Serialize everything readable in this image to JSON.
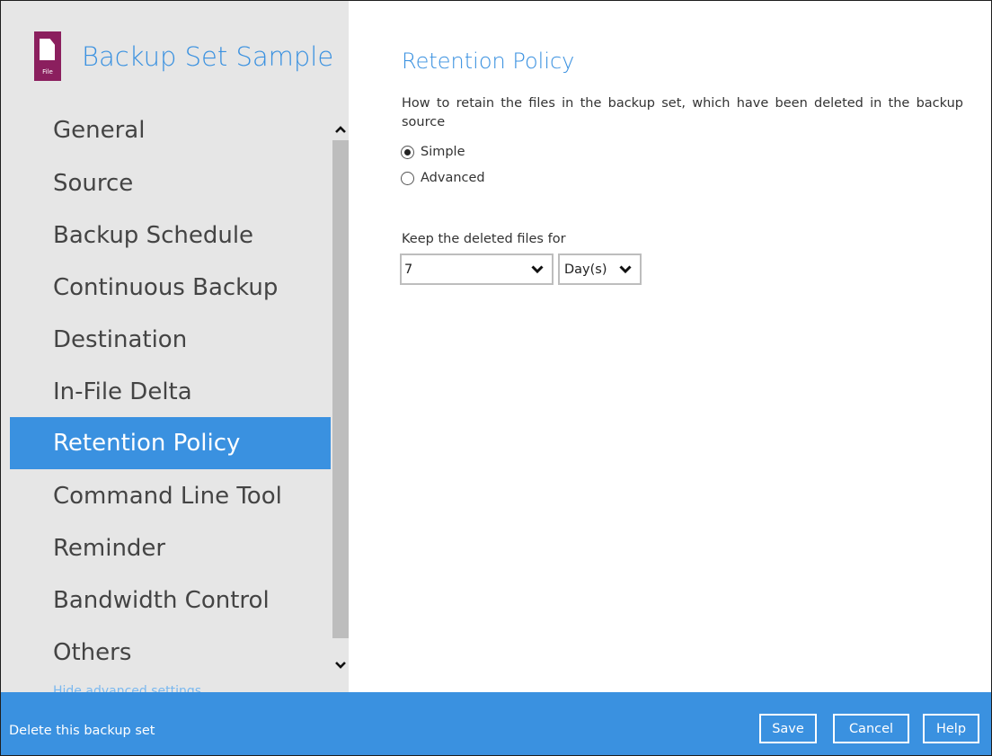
{
  "backup_set": {
    "title": "Backup Set Sample",
    "icon": "file-icon",
    "icon_tag": "File",
    "icon_color": "#8b1f5e"
  },
  "sidebar": {
    "items": [
      {
        "label": "General",
        "active": false
      },
      {
        "label": "Source",
        "active": false
      },
      {
        "label": "Backup Schedule",
        "active": false
      },
      {
        "label": "Continuous Backup",
        "active": false
      },
      {
        "label": "Destination",
        "active": false
      },
      {
        "label": "In-File Delta",
        "active": false
      },
      {
        "label": "Retention Policy",
        "active": true
      },
      {
        "label": "Command Line Tool",
        "active": false
      },
      {
        "label": "Reminder",
        "active": false
      },
      {
        "label": "Bandwidth Control",
        "active": false
      },
      {
        "label": "Others",
        "active": false
      }
    ],
    "hide_advanced_label": "Hide advanced settings"
  },
  "main": {
    "title": "Retention Policy",
    "description": "How to retain the files in the backup set, which have been deleted in the backup source",
    "options": [
      {
        "label": "Simple",
        "checked": true
      },
      {
        "label": "Advanced",
        "checked": false
      }
    ],
    "keep_label": "Keep the deleted files for",
    "keep_value": "7",
    "keep_unit": "Day(s)"
  },
  "footer": {
    "delete_label": "Delete this backup set",
    "save_label": "Save",
    "cancel_label": "Cancel",
    "help_label": "Help"
  },
  "colors": {
    "accent": "#3a91e0",
    "sidebar_bg": "#e6e6e6",
    "scrollbar_thumb": "#bdbdbd"
  }
}
